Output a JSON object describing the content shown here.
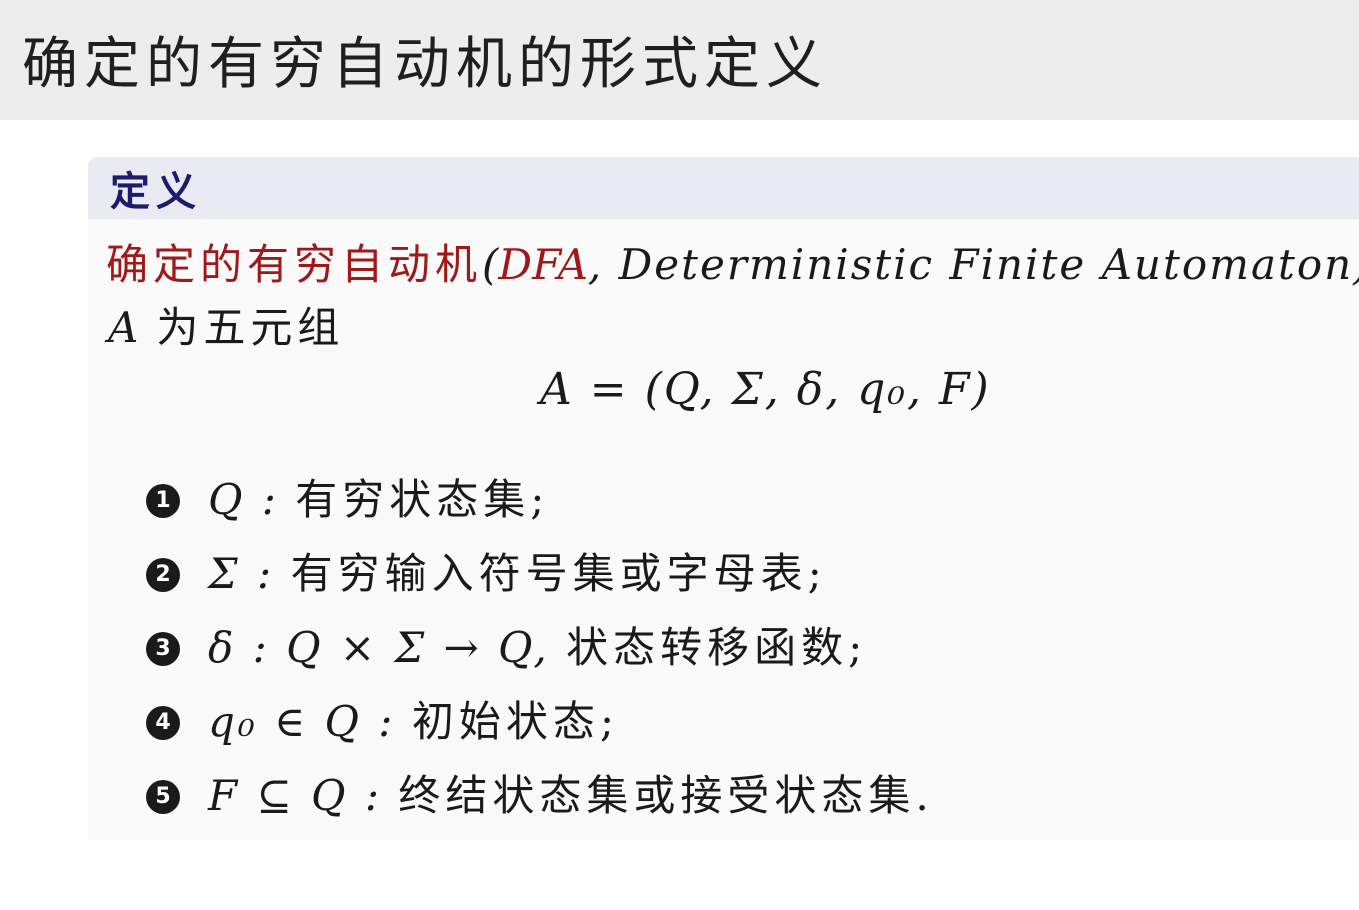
{
  "slide": {
    "title": "确定的有穷自动机的形式定义"
  },
  "definition_block": {
    "header": "定义",
    "term_chinese": "确定的有穷自动机",
    "paren_open": "(",
    "abbr": "DFA",
    "full_name": ", Deterministic Finite Automaton)",
    "tuple_var": "A",
    "tuple_desc": "为五元组",
    "formula": "A = (Q, Σ, δ, q₀, F)",
    "items": [
      {
        "marker": "1",
        "symbol": "Q :",
        "desc": "有穷状态集;"
      },
      {
        "marker": "2",
        "symbol": "Σ :",
        "desc": "有穷输入符号集或字母表;"
      },
      {
        "marker": "3",
        "symbol": "δ : Q × Σ → Q,",
        "desc": "状态转移函数;"
      },
      {
        "marker": "4",
        "symbol": "q₀ ∈ Q :",
        "desc": "初始状态;"
      },
      {
        "marker": "5",
        "symbol": "F ⊆ Q :",
        "desc": "终结状态集或接受状态集."
      }
    ]
  }
}
